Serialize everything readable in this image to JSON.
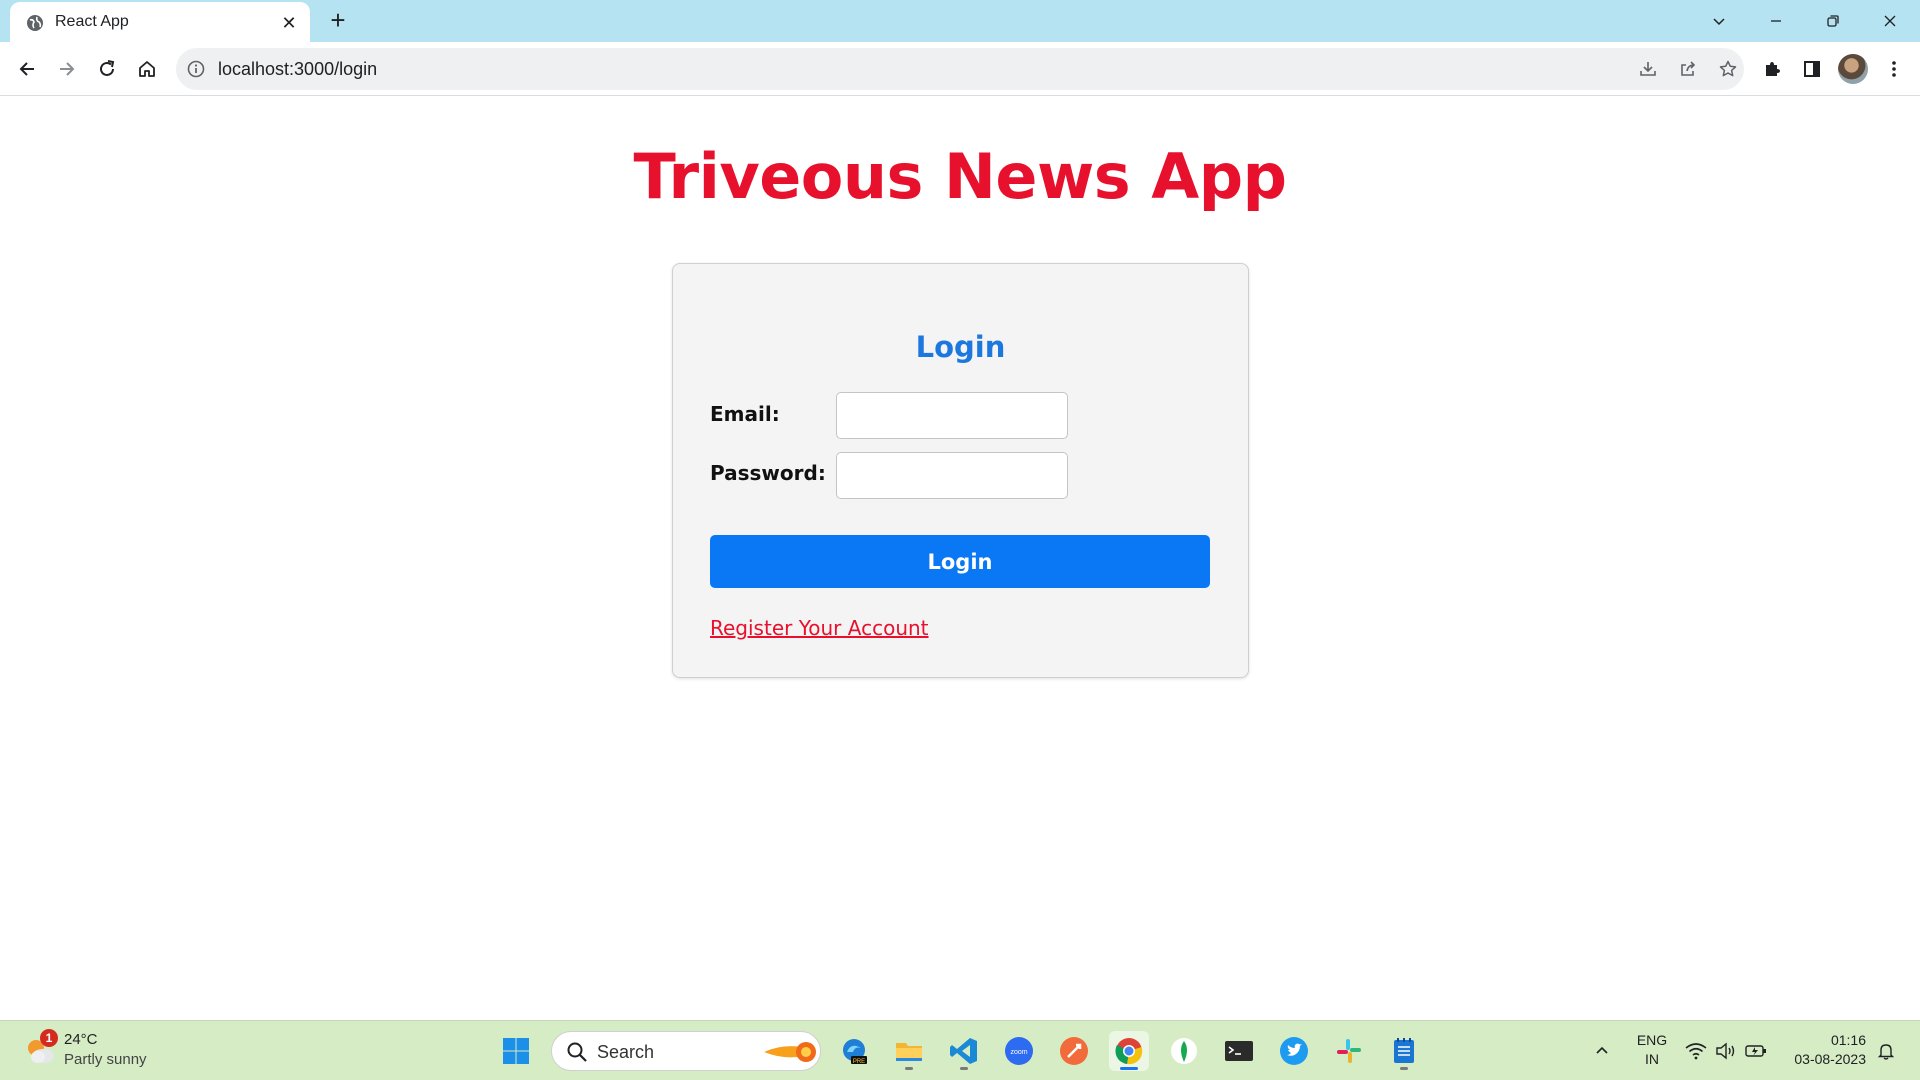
{
  "browser": {
    "tab_title": "React App",
    "url": "localhost:3000/login",
    "icons": [
      "globe-icon",
      "close-icon",
      "plus-icon",
      "chevron-down-icon",
      "minimize-icon",
      "restore-icon",
      "window-close-icon",
      "back-icon",
      "forward-icon",
      "reload-icon",
      "home-icon",
      "info-icon",
      "install-icon",
      "share-icon",
      "star-icon",
      "puzzle-icon",
      "side-panel-icon",
      "more-icon"
    ]
  },
  "page": {
    "app_title": "Triveous News App",
    "form_title": "Login",
    "email_label": "Email:",
    "email_value": "",
    "password_label": "Password:",
    "password_value": "",
    "login_button": "Login",
    "register_link": "Register Your Account",
    "colors": {
      "title": "#e8112d",
      "heading": "#1c78de",
      "button": "#0a78f5",
      "link": "#e8112d"
    }
  },
  "taskbar": {
    "weather": {
      "temp": "24°C",
      "desc": "Partly sunny",
      "badge": "1"
    },
    "search_placeholder": "Search",
    "apps": [
      "windows-start-icon",
      "search-icon",
      "edge-dev-icon",
      "file-explorer-icon",
      "vscode-icon",
      "zoom-icon",
      "postman-icon",
      "chrome-icon",
      "mongodb-icon",
      "terminal-icon",
      "twitter-icon",
      "slack-icon",
      "notepad-icon"
    ],
    "lang_top": "ENG",
    "lang_bottom": "IN",
    "time": "01:16",
    "date": "03-08-2023"
  }
}
